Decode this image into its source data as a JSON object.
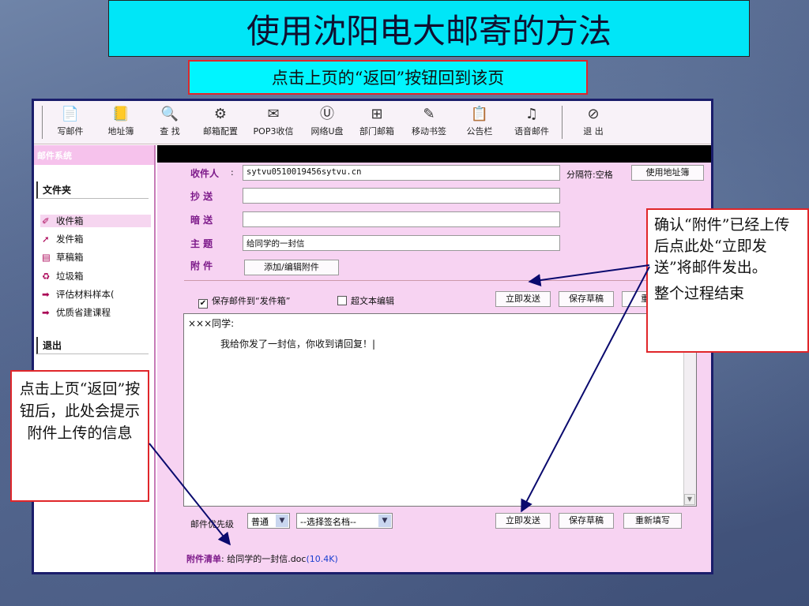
{
  "slide": {
    "title": "使用沈阳电大邮寄的方法",
    "subtitle": "点击上页的“返回”按钮回到该页"
  },
  "toolbar": {
    "items": [
      {
        "label": "写邮件",
        "icon": "write-mail-icon",
        "glyph": "📄"
      },
      {
        "label": "地址簿",
        "icon": "address-book-icon",
        "glyph": "📒"
      },
      {
        "label": "查 找",
        "icon": "search-icon",
        "glyph": "🔍"
      },
      {
        "label": "邮箱配置",
        "icon": "config-icon",
        "glyph": "⚙"
      },
      {
        "label": "POP3收信",
        "icon": "pop3-icon",
        "glyph": "✉"
      },
      {
        "label": "网络U盘",
        "icon": "netdisk-icon",
        "glyph": "Ⓤ"
      },
      {
        "label": "部门邮箱",
        "icon": "dept-mail-icon",
        "glyph": "⊞"
      },
      {
        "label": "移动书签",
        "icon": "bookmark-icon",
        "glyph": "✎"
      },
      {
        "label": "公告栏",
        "icon": "bulletin-icon",
        "glyph": "📋"
      },
      {
        "label": "语音邮件",
        "icon": "voice-mail-icon",
        "glyph": "♫"
      },
      {
        "label": "退 出",
        "icon": "exit-icon",
        "glyph": "⊘"
      }
    ]
  },
  "sidebar": {
    "header": "邮件系统",
    "folders_title": "文件夹",
    "items": [
      {
        "label": "收件箱",
        "glyph": "✐"
      },
      {
        "label": "发件箱",
        "glyph": "➚"
      },
      {
        "label": "草稿箱",
        "glyph": "▤"
      },
      {
        "label": "垃圾箱",
        "glyph": "♻"
      },
      {
        "label": "评估材料样本(",
        "glyph": "➡"
      },
      {
        "label": "优质省建课程",
        "glyph": "➡"
      }
    ],
    "logout": "退出"
  },
  "compose": {
    "to_label": "收件人",
    "to_value": "sytvu0510019456sytvu.cn",
    "cc_label": "抄  送",
    "bcc_label": "暗  送",
    "subject_label": "主  题",
    "subject_value": "给同学的一封信",
    "attach_label": "附  件",
    "attach_button": "添加/编辑附件",
    "separator_hint": "分隔符:空格",
    "address_book_button": "使用地址簿",
    "save_to_outbox": "保存邮件到“发件箱”",
    "rich_text": "超文本编辑",
    "send_button": "立即发送",
    "save_draft_button": "保存草稿",
    "rewrite_button": "重新填写",
    "rewrite_button_clipped": "重新",
    "body_line1": "×××同学:",
    "body_line2": "我给你发了一封信，你收到请回复！|",
    "priority_label": "邮件优先级",
    "priority_value": "普通",
    "signature_value": "--选择签名档--",
    "attachment_list_label": "附件清单",
    "attachment_name": "给同学的一封信.doc",
    "attachment_size": "(10.4K)"
  },
  "callouts": {
    "right_line1": "确认“附件”已经上传后点此处“立即发送”将邮件发出。",
    "right_line2": "整个过程结束",
    "left": "点击上页“返回”按钮后，此处会提示附件上传的信息"
  },
  "colors": {
    "title_bg": "#00e6f7",
    "callout_border": "#e0262a",
    "main_bg": "#f7d3f2",
    "label_color": "#7d1a8a"
  }
}
